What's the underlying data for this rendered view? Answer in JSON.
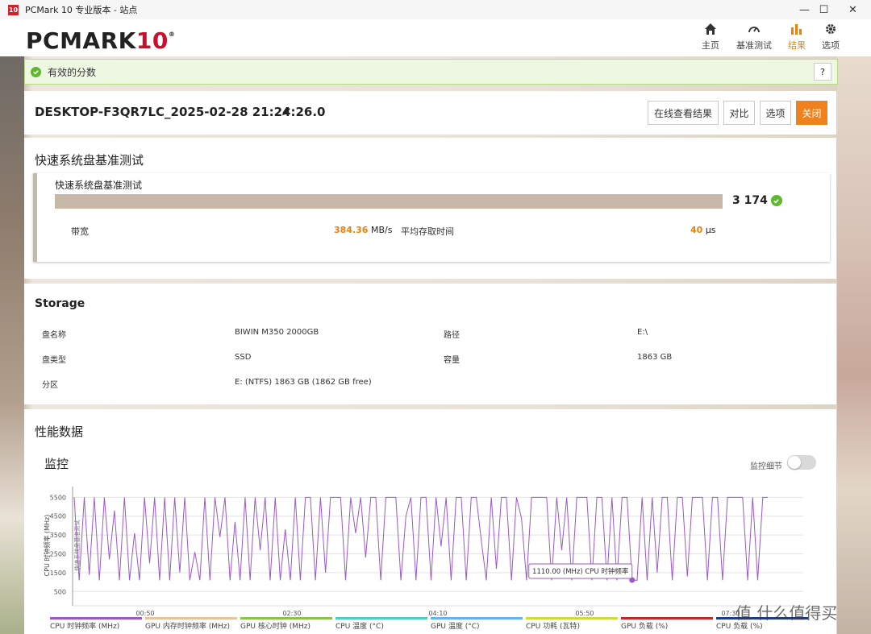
{
  "window": {
    "app_icon_text": "10",
    "title": "PCMark 10 专业版本 - 站点",
    "controls": [
      "—",
      "☐",
      "✕"
    ]
  },
  "header": {
    "logo_main": "PCMARK",
    "logo_num": "10",
    "logo_reg": "®",
    "nav": [
      {
        "label": "主页",
        "icon": "home-icon"
      },
      {
        "label": "基准测试",
        "icon": "gauge-icon"
      },
      {
        "label": "结果",
        "icon": "bar-chart-icon",
        "active": true
      },
      {
        "label": "选项",
        "icon": "gear-icon"
      }
    ],
    "accent": "#e8820e"
  },
  "notice": {
    "text": "有效的分数",
    "help": "?"
  },
  "result": {
    "title": "DESKTOP-F3QR7LC_2025-02-28 21:24:26.0",
    "buttons": {
      "online": "在线查看结果",
      "compare": "对比",
      "options": "选项",
      "close": "关闭"
    }
  },
  "quick": {
    "section_title": "快速系统盘基准测试",
    "card_title": "快速系统盘基准测试",
    "score": "3 174",
    "bandwidth_label": "带宽",
    "bandwidth_value": "384.36",
    "bandwidth_unit": "MB/s",
    "access_label": "平均存取时间",
    "access_value": "40",
    "access_unit": "μs"
  },
  "storage": {
    "title": "Storage",
    "rows": [
      {
        "k1": "盘名称",
        "v1": "BIWIN M350 2000GB",
        "k2": "路径",
        "v2": "E:\\"
      },
      {
        "k1": "盘类型",
        "v1": "SSD",
        "k2": "容量",
        "v2": "1863 GB"
      },
      {
        "k1": "分区",
        "v1": "E: (NTFS) 1863 GB (1862 GB free)",
        "k2": "",
        "v2": ""
      }
    ]
  },
  "perf": {
    "title": "性能数据",
    "monitor": "监控",
    "toggle_label": "监控细节",
    "tooltip": "1110.00 (MHz) CPU 时钟频率",
    "legend": [
      {
        "name": "CPU 时钟频率 (MHz)",
        "color": "#9b59c6"
      },
      {
        "name": "GPU 内存时钟频率 (MHz)",
        "color": "#e8c39a"
      },
      {
        "name": "GPU 核心时钟 (MHz)",
        "color": "#8bc34a"
      },
      {
        "name": "CPU 温度 (°C)",
        "color": "#4dd0c4"
      },
      {
        "name": "GPU 温度 (°C)",
        "color": "#64b5f6"
      },
      {
        "name": "CPU 功耗 (瓦特)",
        "color": "#cddc39"
      },
      {
        "name": "GPU 负载 (%)",
        "color": "#c62828"
      },
      {
        "name": "CPU 负载 (%)",
        "color": "#1e3a8a"
      }
    ]
  },
  "chart_data": {
    "type": "line",
    "ylabel": "CPU 时钟频率 (MHz)",
    "ylabel2": "快速系统盘基准测试",
    "yticks": [
      500,
      1500,
      2500,
      3500,
      4500,
      5500
    ],
    "ylim": [
      0,
      5900
    ],
    "xticks": [
      "00:50",
      "02:30",
      "04:10",
      "05:50",
      "07:30"
    ],
    "grid": true,
    "series": [
      {
        "name": "CPU 时钟频率 (MHz)",
        "values": [
          5500,
          1100,
          5500,
          1400,
          5500,
          1100,
          5500,
          2200,
          4800,
          1100,
          5500,
          1100,
          3600,
          1100,
          5500,
          2000,
          5500,
          1100,
          5500,
          1100,
          5500,
          1500,
          5500,
          1100,
          2600,
          1100,
          5500,
          1100,
          5500,
          3400,
          5500,
          1100,
          4200,
          1100,
          5500,
          1100,
          5500,
          2700,
          5500,
          1100,
          5500,
          1100,
          3800,
          1100,
          5500,
          1100,
          5500,
          5500,
          1100,
          5500,
          1500,
          5500,
          5500,
          5500,
          1100,
          5500,
          3600,
          5500,
          2300,
          5500,
          5500,
          1100,
          5500,
          5500,
          5500,
          1100,
          4500,
          5500,
          1100,
          5500,
          5500,
          1100,
          5500,
          2900,
          5500,
          1100,
          5500,
          5500,
          1100,
          5500,
          5500,
          3200,
          1100,
          5500,
          1700,
          5500,
          5500,
          1100,
          5500,
          4400,
          1100,
          5500,
          5500,
          5500,
          5500,
          1100,
          5500,
          2700,
          5500,
          1100,
          5500,
          5500,
          5500,
          1100,
          5500,
          5500,
          1100,
          5500,
          1100,
          5500,
          5500,
          1110,
          1100,
          5500,
          1100,
          5500,
          1500,
          5500,
          5500,
          1100,
          5500,
          5500,
          1300,
          5500,
          5500,
          5500,
          1100,
          5500,
          5500,
          1100,
          5500,
          5500,
          5500,
          5500,
          1100,
          5500,
          1100,
          5500,
          5500
        ]
      }
    ]
  },
  "watermark": {
    "text": "值 什么值得买"
  }
}
